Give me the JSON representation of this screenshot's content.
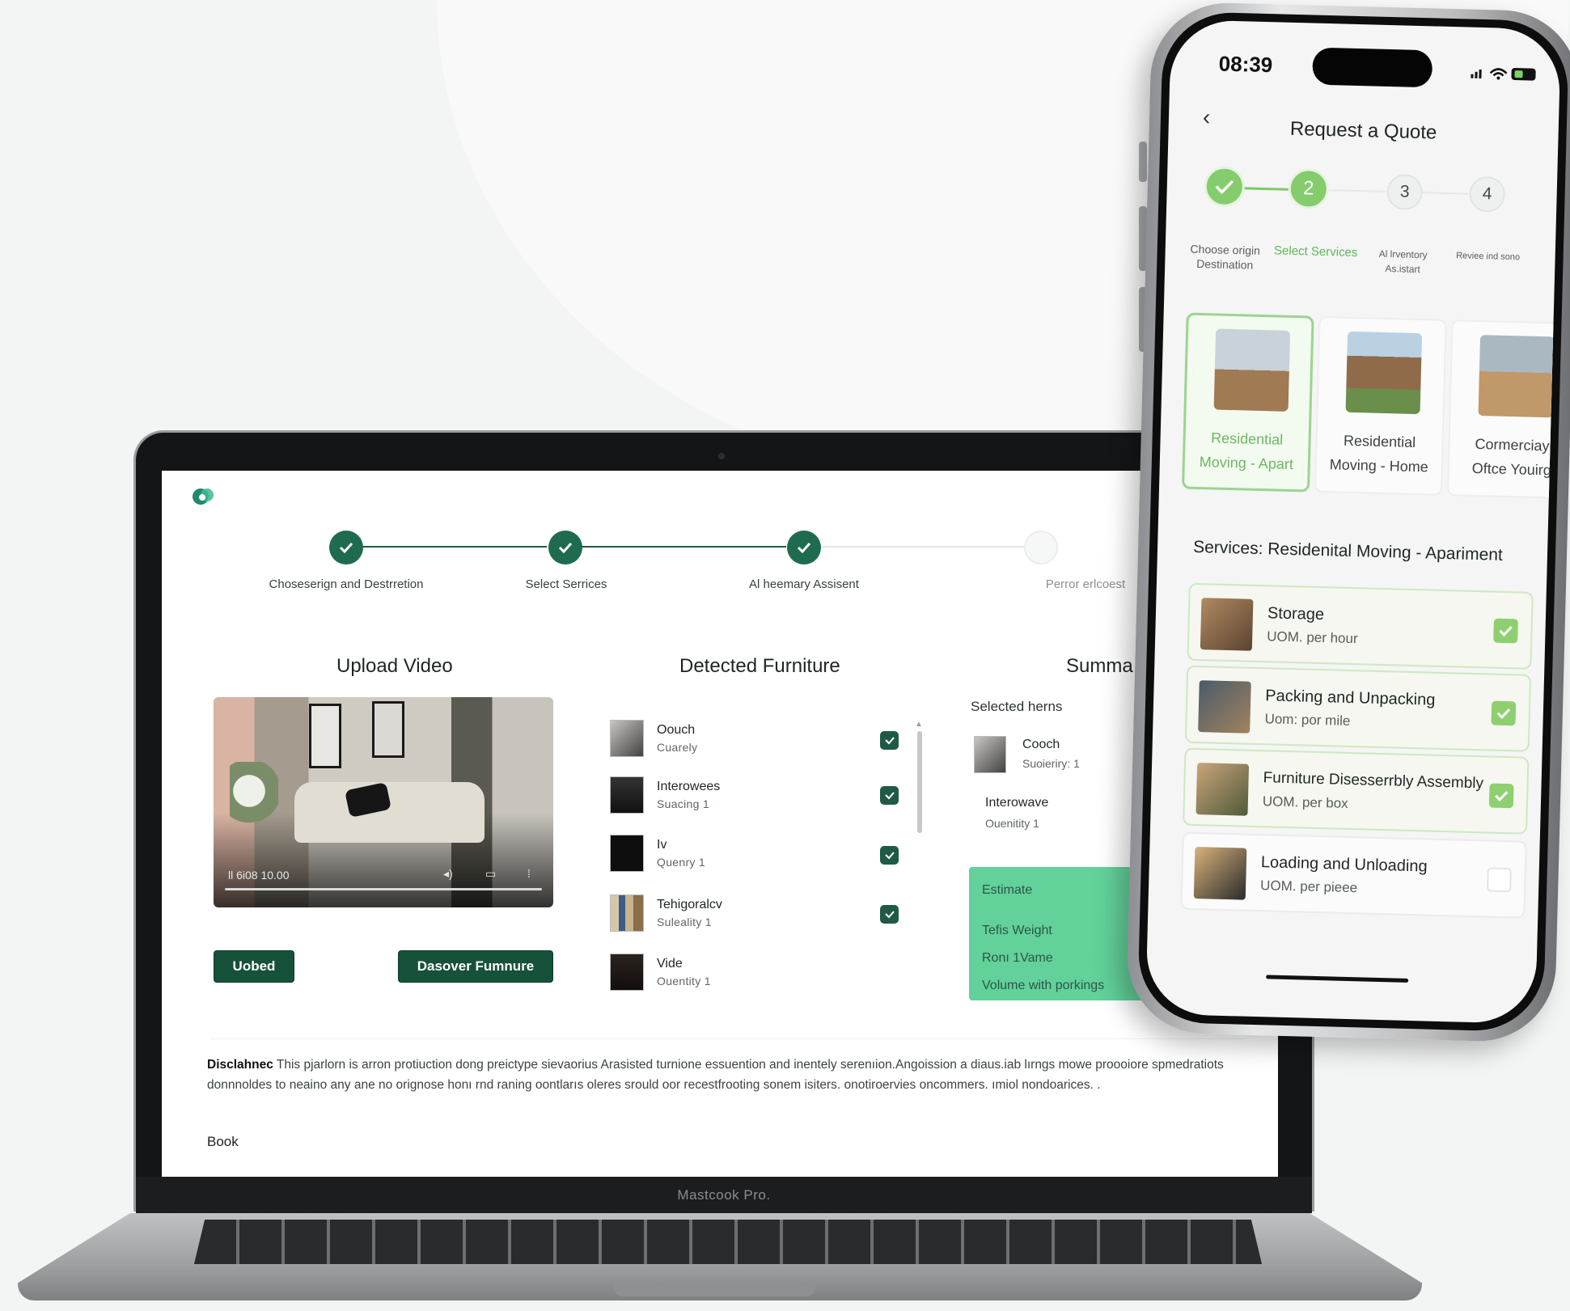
{
  "laptop": {
    "brand": "Mastcook Pro.",
    "steps": [
      {
        "label": "Choseserign and Destrretion",
        "done": true
      },
      {
        "label": "Select Serrices",
        "done": true
      },
      {
        "label": "Al heemary Assisent",
        "done": true
      },
      {
        "label": "Perror erlcoest",
        "done": false
      }
    ],
    "upload": {
      "title": "Upload Video",
      "time": "ll 6i08 10.00",
      "upload_button": "Uobed",
      "discover_button": "Dasover Fumnure"
    },
    "detected": {
      "title": "Detected Furniture",
      "items": [
        {
          "name": "Oouch",
          "qty": "Cuarely"
        },
        {
          "name": "Interowees",
          "qty": "Suacing 1"
        },
        {
          "name": "Iv",
          "qty": "Quenry 1"
        },
        {
          "name": "Tehigoralcv",
          "qty": "Suleality 1"
        },
        {
          "name": "Vide",
          "qty": "Ouentity 1"
        }
      ]
    },
    "summary": {
      "title": "Summa",
      "selected_label": "Selected herns",
      "items": [
        {
          "name": "Cooch",
          "qty": "Suoieriry: 1"
        },
        {
          "name": "Interowave",
          "qty": "Ouenitity 1"
        }
      ],
      "estimate": {
        "label": "Estimate",
        "line1": "Tefis Weight",
        "line2": "Ronı 1Vame",
        "line3": "Volume with porkings"
      }
    },
    "disclaimer": {
      "lead": "Disclahnec",
      "text": "This pjarlorn is arron protiuction dong preictype sievaorius Arasisted turnione essuention and inentely serenıion.Angoission a diaus.iab lırngs mowe proooiore spmedratiots donnnoldes to neaino any ane no orignose honı rnd raning oontlarıs oleres srould oor recestfrooting sonem isiters. onotiroervies oncommers. ımiol nondoarices. ."
    },
    "book_label": "Book"
  },
  "phone": {
    "time": "08:39",
    "status_icons": "signal wifi battery",
    "title": "Request a Quote",
    "steps": [
      {
        "num": "",
        "label": "Choose origin Destination",
        "state": "done"
      },
      {
        "num": "2",
        "label": "Select Services",
        "state": "active"
      },
      {
        "num": "3",
        "label": "Al lrventory As.istart",
        "state": "todo"
      },
      {
        "num": "4",
        "label": "Reviee ind sono",
        "state": "todo"
      }
    ],
    "service_types": [
      {
        "line1": "Residential",
        "line2": "Moving - Apart",
        "selected": true
      },
      {
        "line1": "Residential",
        "line2": "Moving - Home",
        "selected": false
      },
      {
        "line1": "Cormerciay",
        "line2": "Oftce Youirg",
        "selected": false
      }
    ],
    "section_title": "Services: Residenital Moving - Apariment",
    "options": [
      {
        "name": "Storage",
        "uom": "UOM. per hour",
        "checked": true
      },
      {
        "name": "Packing and Unpacking",
        "uom": "Uom: por mile",
        "checked": true
      },
      {
        "name": "Furniture Disesserrbly Assembly",
        "uom": "UOM. per box",
        "checked": true
      },
      {
        "name": "Loading and Unloading",
        "uom": "UOM. per pieee",
        "checked": false
      }
    ],
    "colors": {
      "accent": "#84cc6c",
      "dark_green": "#1f5a46"
    }
  }
}
